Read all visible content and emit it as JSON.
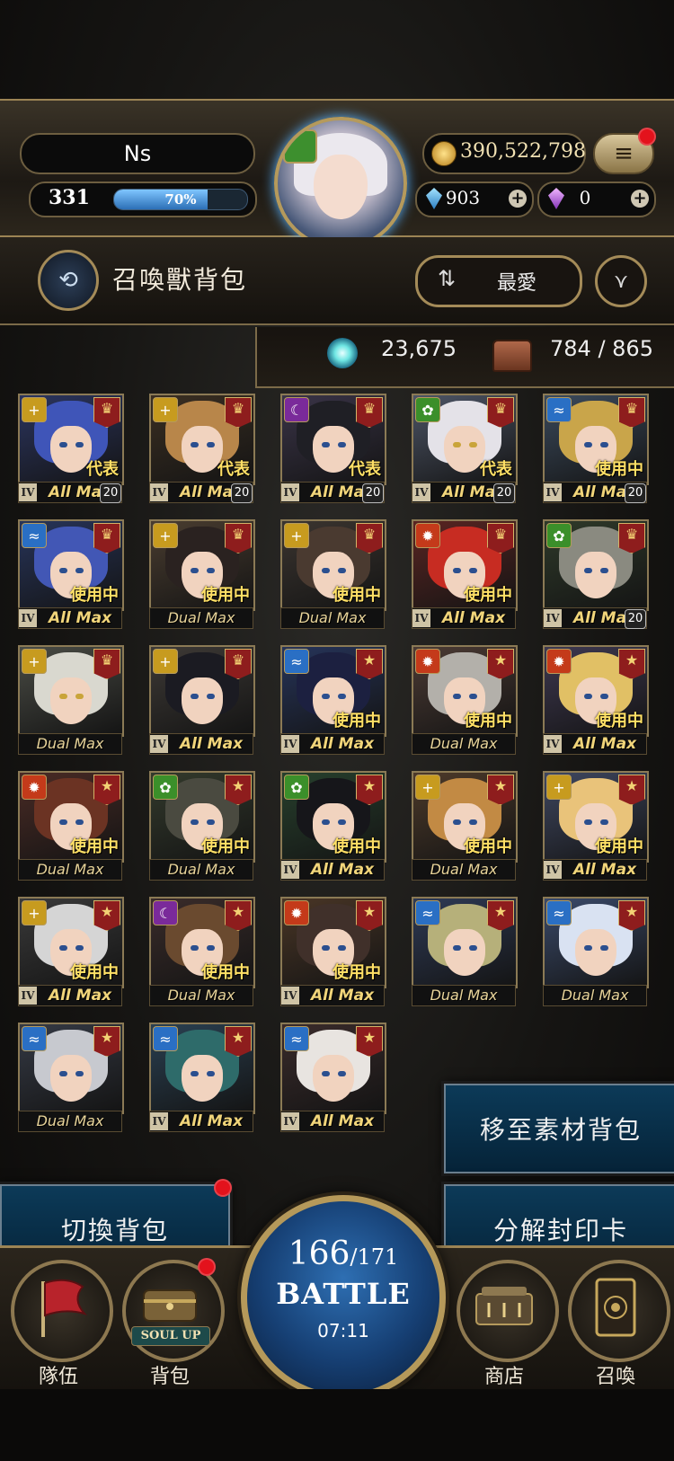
{
  "player": {
    "name": "Ns",
    "level": "331",
    "exp_percent_label": "70%",
    "exp_fraction": 0.7
  },
  "currencies": {
    "gold": "390,522,798",
    "blue_crystal": "903",
    "purple_crystal": "0"
  },
  "header": {
    "title": "召喚獸背包",
    "sort_label": "最愛"
  },
  "inventory": {
    "souls": "23,675",
    "capacity": "784 / 865"
  },
  "cards": [
    {
      "element": "light",
      "rarity_icon": "crown",
      "status": "代表",
      "max": "All Max",
      "lvl": "20",
      "rank": "IV",
      "hair": "#3f55b8",
      "bg": "#2b3560"
    },
    {
      "element": "light",
      "rarity_icon": "crown",
      "status": "代表",
      "max": "All Max",
      "lvl": "20",
      "rank": "IV",
      "hair": "#b8864a",
      "bg": "#3b2f22"
    },
    {
      "element": "dark",
      "rarity_icon": "crown",
      "status": "代表",
      "max": "All Max",
      "lvl": "20",
      "rank": "IV",
      "hair": "#1f1f25",
      "bg": "#3a3448"
    },
    {
      "element": "wood",
      "rarity_icon": "crown",
      "status": "代表",
      "max": "All Max",
      "lvl": "20",
      "rank": "IV",
      "hair": "#e4e2e8",
      "bg": "#4d5566"
    },
    {
      "element": "water",
      "rarity_icon": "crown",
      "status": "使用中",
      "max": "All Max",
      "lvl": "20",
      "rank": "IV",
      "hair": "#c9a54a",
      "bg": "#3b4a5c"
    },
    {
      "element": "water",
      "rarity_icon": "crown",
      "status": "使用中",
      "max": "All Max",
      "lvl": "",
      "rank": "IV",
      "hair": "#4257b5",
      "bg": "#27345a"
    },
    {
      "element": "light",
      "rarity_icon": "crown",
      "status": "使用中",
      "max": "Dual Max",
      "lvl": "",
      "rank": "",
      "hair": "#2a2220",
      "bg": "#4a3d30"
    },
    {
      "element": "light",
      "rarity_icon": "crown",
      "status": "使用中",
      "max": "Dual Max",
      "lvl": "",
      "rank": "",
      "hair": "#4a3a30",
      "bg": "#3b3530"
    },
    {
      "element": "fire",
      "rarity_icon": "crown",
      "status": "使用中",
      "max": "All Max",
      "lvl": "",
      "rank": "IV",
      "hair": "#c72c22",
      "bg": "#5a2522"
    },
    {
      "element": "wood",
      "rarity_icon": "crown",
      "status": "",
      "max": "All Max",
      "lvl": "20",
      "rank": "IV",
      "hair": "#8a8a80",
      "bg": "#2f3a2a"
    },
    {
      "element": "light",
      "rarity_icon": "crown",
      "status": "",
      "max": "Dual Max",
      "lvl": "",
      "rank": "",
      "hair": "#d9d8cf",
      "bg": "#4a4c45"
    },
    {
      "element": "light",
      "rarity_icon": "crown",
      "status": "",
      "max": "All Max",
      "lvl": "",
      "rank": "IV",
      "hair": "#1b1b22",
      "bg": "#3e3a36"
    },
    {
      "element": "water",
      "rarity_icon": "star",
      "status": "使用中",
      "max": "All Max",
      "lvl": "",
      "rank": "IV",
      "hair": "#1c2040",
      "bg": "#26345a"
    },
    {
      "element": "fire",
      "rarity_icon": "star",
      "status": "使用中",
      "max": "Dual Max",
      "lvl": "",
      "rank": "",
      "hair": "#b3b0aa",
      "bg": "#4c3b34"
    },
    {
      "element": "fire",
      "rarity_icon": "star",
      "status": "使用中",
      "max": "All Max",
      "lvl": "",
      "rank": "IV",
      "hair": "#e1c065",
      "bg": "#3e3850"
    },
    {
      "element": "fire",
      "rarity_icon": "star",
      "status": "使用中",
      "max": "Dual Max",
      "lvl": "",
      "rank": "",
      "hair": "#6b3323",
      "bg": "#4a2b25"
    },
    {
      "element": "wood",
      "rarity_icon": "star",
      "status": "使用中",
      "max": "Dual Max",
      "lvl": "",
      "rank": "",
      "hair": "#4a4a40",
      "bg": "#333a2c"
    },
    {
      "element": "wood",
      "rarity_icon": "star",
      "status": "使用中",
      "max": "All Max",
      "lvl": "",
      "rank": "IV",
      "hair": "#16161a",
      "bg": "#27402d"
    },
    {
      "element": "light",
      "rarity_icon": "star",
      "status": "使用中",
      "max": "Dual Max",
      "lvl": "",
      "rank": "",
      "hair": "#c28a44",
      "bg": "#4d3a2a"
    },
    {
      "element": "light",
      "rarity_icon": "star",
      "status": "使用中",
      "max": "All Max",
      "lvl": "",
      "rank": "IV",
      "hair": "#e9c37a",
      "bg": "#3f4760"
    },
    {
      "element": "light",
      "rarity_icon": "star",
      "status": "使用中",
      "max": "All Max",
      "lvl": "",
      "rank": "IV",
      "hair": "#d5d5d5",
      "bg": "#3a3a3a"
    },
    {
      "element": "dark",
      "rarity_icon": "star",
      "status": "使用中",
      "max": "Dual Max",
      "lvl": "",
      "rank": "",
      "hair": "#6a4a2f",
      "bg": "#3a2c2a"
    },
    {
      "element": "fire",
      "rarity_icon": "star",
      "status": "使用中",
      "max": "All Max",
      "lvl": "",
      "rank": "IV",
      "hair": "#40302a",
      "bg": "#4a3626"
    },
    {
      "element": "water",
      "rarity_icon": "star",
      "status": "",
      "max": "Dual Max",
      "lvl": "",
      "rank": "",
      "hair": "#b6b07a",
      "bg": "#2e3a55"
    },
    {
      "element": "water",
      "rarity_icon": "star",
      "status": "",
      "max": "Dual Max",
      "lvl": "",
      "rank": "",
      "hair": "#d9e2f2",
      "bg": "#3a4a6a"
    },
    {
      "element": "water",
      "rarity_icon": "star",
      "status": "",
      "max": "Dual Max",
      "lvl": "",
      "rank": "",
      "hair": "#c7c9cf",
      "bg": "#353a45"
    },
    {
      "element": "water",
      "rarity_icon": "star",
      "status": "",
      "max": "All Max",
      "lvl": "",
      "rank": "IV",
      "hair": "#2e6b6a",
      "bg": "#2a4052"
    },
    {
      "element": "water",
      "rarity_icon": "star",
      "status": "",
      "max": "All Max",
      "lvl": "",
      "rank": "IV",
      "hair": "#e8e4e0",
      "bg": "#3a2b2b"
    }
  ],
  "actions": {
    "move_to_material": "移至素材背包",
    "switch_bag": "切換背包",
    "decompose": "分解封印卡"
  },
  "battle": {
    "current": "166",
    "max": "/171",
    "label": "BATTLE",
    "timer": "07:11"
  },
  "nav": {
    "team": "隊伍",
    "bag": "背包",
    "soul_up": "SOUL UP",
    "shop": "商店",
    "summon": "召喚"
  },
  "colors": {
    "frame_gold": "#9c8454",
    "status_yellow": "#ffe066",
    "button_blue": "#0c3a58",
    "notification_red": "#e3121c"
  }
}
